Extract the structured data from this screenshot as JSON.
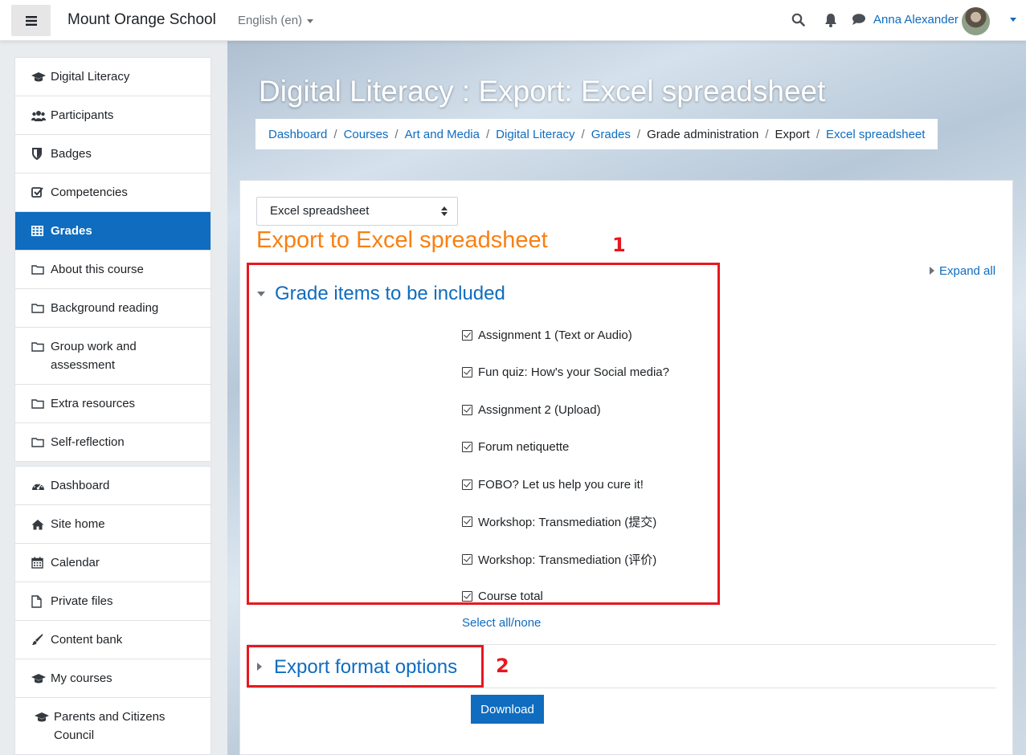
{
  "navbar": {
    "site_name": "Mount Orange School",
    "language": "English (en)",
    "user_name": "Anna Alexander"
  },
  "sidebar": {
    "course_items": [
      {
        "label": "Digital Literacy",
        "icon": "graduation-cap-icon"
      },
      {
        "label": "Participants",
        "icon": "users-icon"
      },
      {
        "label": "Badges",
        "icon": "shield-icon"
      },
      {
        "label": "Competencies",
        "icon": "check-square-icon"
      },
      {
        "label": "Grades",
        "icon": "table-icon",
        "active": true
      },
      {
        "label": "About this course",
        "icon": "folder-icon"
      },
      {
        "label": "Background reading",
        "icon": "folder-icon"
      },
      {
        "label": "Group work and assessment",
        "icon": "folder-icon"
      },
      {
        "label": "Extra resources",
        "icon": "folder-icon"
      },
      {
        "label": "Self-reflection",
        "icon": "folder-icon"
      }
    ],
    "site_items": [
      {
        "label": "Dashboard",
        "icon": "tachometer-icon"
      },
      {
        "label": "Site home",
        "icon": "home-icon"
      },
      {
        "label": "Calendar",
        "icon": "calendar-icon"
      },
      {
        "label": "Private files",
        "icon": "file-icon"
      },
      {
        "label": "Content bank",
        "icon": "paint-brush-icon"
      },
      {
        "label": "My courses",
        "icon": "graduation-cap-icon"
      },
      {
        "label": "Parents and Citizens Council",
        "icon": "graduation-cap-icon"
      }
    ]
  },
  "header": {
    "title": "Digital Literacy : Export: Excel spreadsheet",
    "breadcrumb": [
      {
        "label": "Dashboard",
        "link": true
      },
      {
        "label": "Courses",
        "link": true
      },
      {
        "label": "Art and Media",
        "link": true
      },
      {
        "label": "Digital Literacy",
        "link": true
      },
      {
        "label": "Grades",
        "link": true
      },
      {
        "label": "Grade administration",
        "link": false
      },
      {
        "label": "Export",
        "link": false
      },
      {
        "label": "Excel spreadsheet",
        "link": true
      }
    ]
  },
  "main": {
    "export_select_value": "Excel spreadsheet",
    "heading": "Export to Excel spreadsheet",
    "expand_all": "Expand all",
    "section1_title": "Grade items to be included",
    "grade_items": [
      "Assignment 1 (Text or Audio)",
      "Fun quiz: How's your Social media?",
      "Assignment 2 (Upload)",
      "Forum netiquette",
      "FOBO? Let us help you cure it!",
      "Workshop: Transmediation (提交)",
      "Workshop: Transmediation (评价)",
      "Course total"
    ],
    "select_all": "Select all/none",
    "section2_title": "Export format options",
    "download_label": "Download"
  },
  "annotations": {
    "label1": "1",
    "label2": "2",
    "color": "#e8171f"
  },
  "colors": {
    "brand": "#0f6cbf",
    "heading_orange": "#f98012"
  }
}
